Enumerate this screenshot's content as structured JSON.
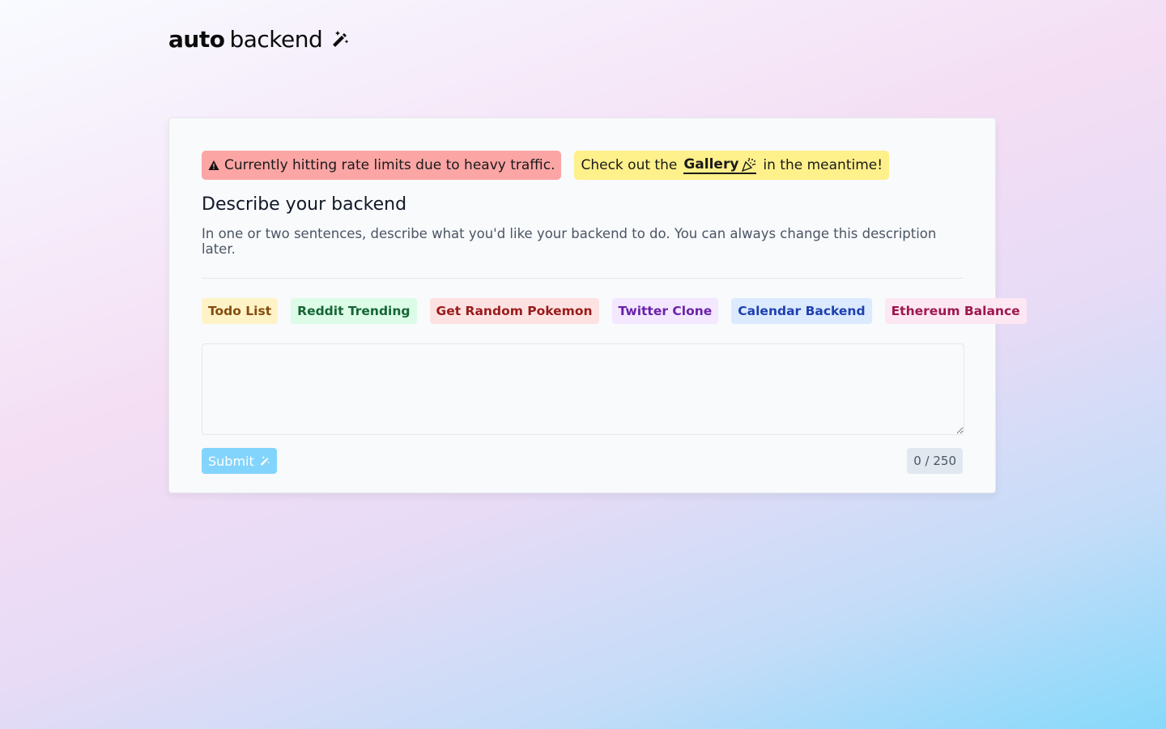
{
  "logo": {
    "bold": "auto",
    "regular": "backend",
    "icon": "magic-wand-icon"
  },
  "notices": {
    "rate_limit": {
      "icon": "warning-icon",
      "text": "Currently hitting rate limits due to heavy traffic.",
      "color": "#fca5a5"
    },
    "gallery": {
      "prefix": "Check out the",
      "link": "Gallery",
      "icon": "party-popper-icon",
      "suffix": "in the meantime!",
      "color": "#fef08a"
    }
  },
  "heading": "Describe your backend",
  "description": "In one or two sentences, describe what you'd like your backend to do. You can always change this description later.",
  "examples": [
    {
      "label": "Todo List",
      "bg": "#fef3c7",
      "fg": "#854d0e"
    },
    {
      "label": "Reddit Trending",
      "bg": "#dcfce7",
      "fg": "#166534"
    },
    {
      "label": "Get Random Pokemon",
      "bg": "#fee2e2",
      "fg": "#991b1b"
    },
    {
      "label": "Twitter Clone",
      "bg": "#f3e8ff",
      "fg": "#6b21a8"
    },
    {
      "label": "Calendar Backend",
      "bg": "#dbeafe",
      "fg": "#1e40af"
    },
    {
      "label": "Ethereum Balance",
      "bg": "#fce7f3",
      "fg": "#9d174d"
    }
  ],
  "input": {
    "value": "",
    "placeholder": ""
  },
  "submit": {
    "label": "Submit",
    "icon": "magic-wand-icon",
    "color": "#7dd3fc"
  },
  "counter": "0 / 250"
}
